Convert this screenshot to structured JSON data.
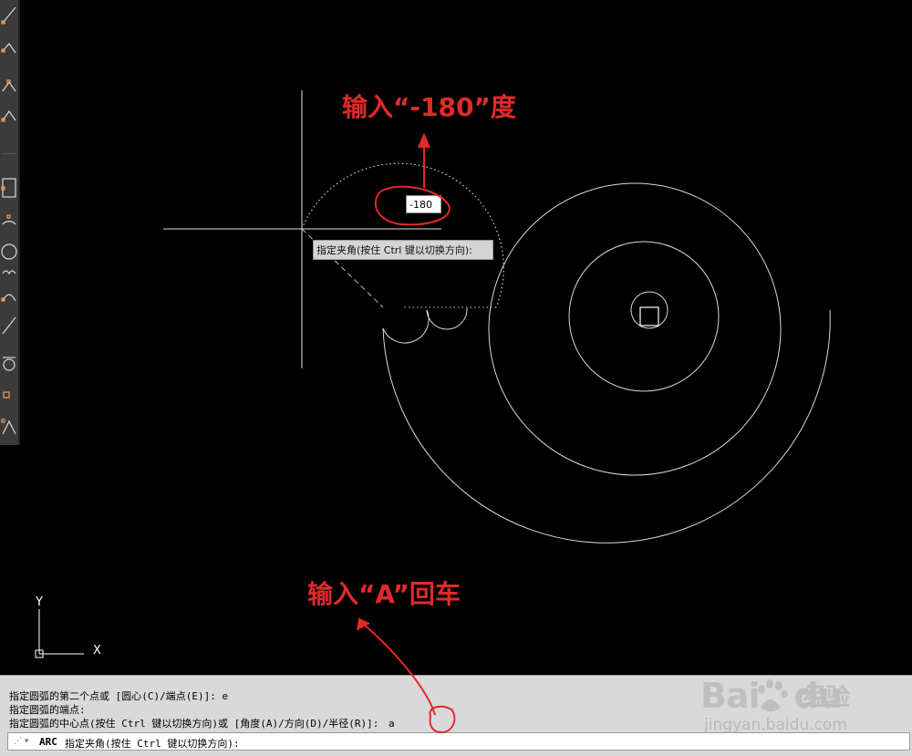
{
  "annotations": {
    "top": "输入“-180”度",
    "bottom": "输入“A”回车"
  },
  "canvas": {
    "dynamic_input_value": "-180",
    "tooltip": "指定夹角(按住 Ctrl 键以切换方向):",
    "ucs": {
      "y_label": "Y",
      "x_label": "X"
    }
  },
  "command": {
    "history": [
      "指定圆弧的第二个点或 [圆心(C)/端点(E)]: e",
      "指定圆弧的端点:",
      "指定圆弧的中心点(按住 Ctrl 键以切换方向)或 [角度(A)/方向(D)/半径(R)]:"
    ],
    "typed_value": "a",
    "current_command": "ARC",
    "prompt": "指定夹角(按住 Ctrl 键以切换方向):"
  },
  "watermark": {
    "logo_text": "Bai",
    "logo_text_2": "du",
    "cn": "经验",
    "url": "jingyan.baidu.com"
  },
  "colors": {
    "annotation": "#e02a2a",
    "drawing": "#ffffff",
    "preview": "#f0b070"
  }
}
